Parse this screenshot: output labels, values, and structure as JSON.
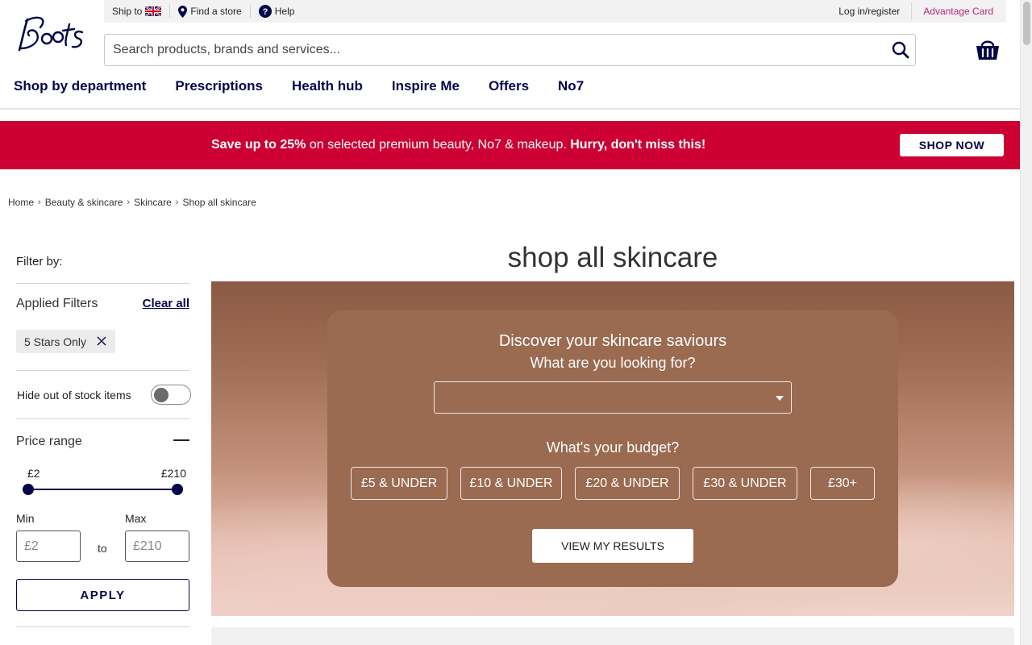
{
  "header": {
    "logo_text": "Boots",
    "utility": {
      "ship_to": "Ship to",
      "find_store": "Find a store",
      "help": "Help",
      "login": "Log in/register",
      "advantage_card": "Advantage Card"
    },
    "search": {
      "placeholder": "Search products, brands and services..."
    },
    "nav": [
      "Shop by department",
      "Prescriptions",
      "Health hub",
      "Inspire Me",
      "Offers",
      "No7"
    ]
  },
  "promo": {
    "bold_lead": "Save up to 25%",
    "middle": " on selected premium beauty, No7 & makeup. ",
    "bold_tail": "Hurry, don't miss this!",
    "button": "SHOP NOW",
    "background": "#cc0033"
  },
  "breadcrumb": [
    "Home",
    "Beauty & skincare",
    "Skincare",
    "Shop all skincare"
  ],
  "filters": {
    "title": "Filter by:",
    "applied_label": "Applied Filters",
    "clear_all": "Clear all",
    "chips": [
      "5 Stars Only"
    ],
    "hide_out_of_stock": "Hide out of stock items",
    "hide_out_of_stock_on": false,
    "price_range_label": "Price range",
    "range_min": "£2",
    "range_max": "£210",
    "min_label": "Min",
    "max_label": "Max",
    "min_placeholder": "£2",
    "max_placeholder": "£210",
    "to": "to",
    "apply": "APPLY"
  },
  "main": {
    "title": "shop all skincare",
    "card": {
      "heading": "Discover your skincare saviours",
      "question": "What are you looking for?",
      "budget_question": "What's your budget?",
      "budgets": [
        "£5 & UNDER",
        "£10 & UNDER",
        "£20 & UNDER",
        "£30 & UNDER",
        "£30+"
      ],
      "results_button": "VIEW MY RESULTS"
    }
  },
  "colors": {
    "brand_navy": "#05054b",
    "advantage_pink": "#b5267e",
    "card_brown": "#9a6a51"
  }
}
